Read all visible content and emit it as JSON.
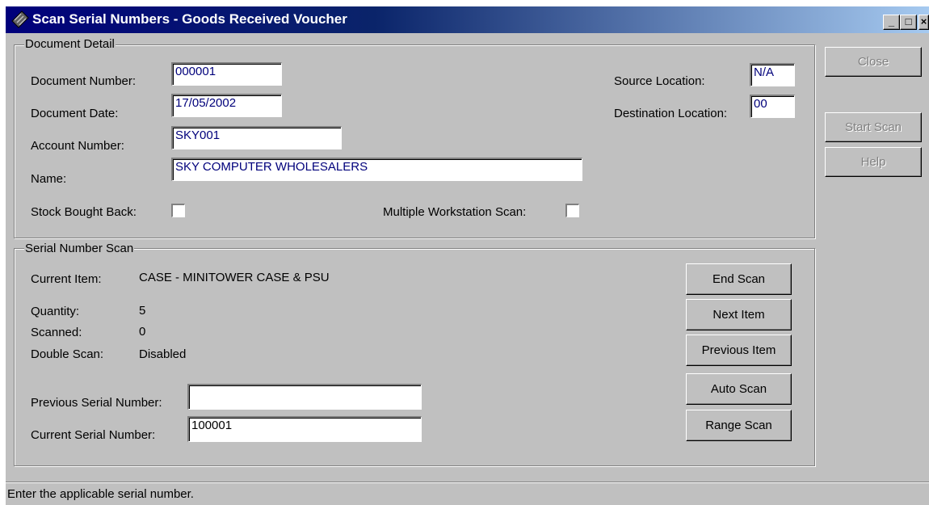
{
  "window": {
    "title": "Scan Serial Numbers - Goods Received Voucher"
  },
  "caption_buttons": {
    "minimize": "_",
    "maximize": "□",
    "close": "×"
  },
  "document_detail": {
    "legend": "Document Detail",
    "document_number_label": "Document Number:",
    "document_number": "000001",
    "document_date_label": "Document Date:",
    "document_date": "17/05/2002",
    "account_number_label": "Account Number:",
    "account_number": "SKY001",
    "name_label": "Name:",
    "name": "SKY COMPUTER WHOLESALERS",
    "source_location_label": "Source Location:",
    "source_location": "N/A",
    "destination_location_label": "Destination Location:",
    "destination_location": "00",
    "stock_bought_back_label": "Stock Bought Back:",
    "stock_bought_back": false,
    "multiple_workstation_label": "Multiple Workstation Scan:",
    "multiple_workstation": false
  },
  "serial_scan": {
    "legend": "Serial Number Scan",
    "current_item_label": "Current Item:",
    "current_item": "CASE - MINITOWER CASE & PSU",
    "quantity_label": "Quantity:",
    "quantity": "5",
    "scanned_label": "Scanned:",
    "scanned": "0",
    "double_scan_label": "Double Scan:",
    "double_scan": "Disabled",
    "previous_serial_label": "Previous Serial Number:",
    "previous_serial": "",
    "current_serial_label": "Current Serial Number:",
    "current_serial": "100001"
  },
  "scan_buttons": {
    "end_scan": "End Scan",
    "next_item": "Next Item",
    "previous_item": "Previous Item",
    "auto_scan": "Auto Scan",
    "range_scan": "Range Scan"
  },
  "side_buttons": {
    "close": "Close",
    "start_scan": "Start Scan",
    "help": "Help"
  },
  "status_bar": {
    "text": "Enter the applicable serial number."
  }
}
